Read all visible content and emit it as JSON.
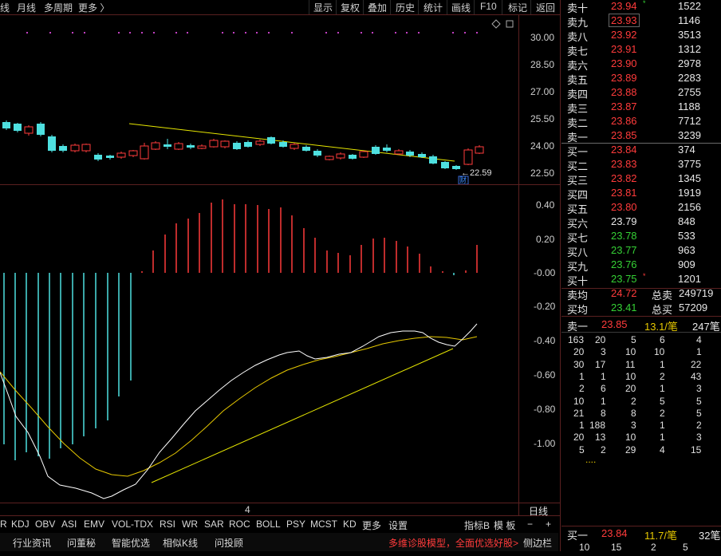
{
  "toolbar": {
    "left": [
      "线",
      "月线",
      "多周期",
      "更多 〉"
    ],
    "right": [
      "显示",
      "复权",
      "叠加",
      "历史",
      "统计",
      "画线",
      "F10",
      "标记",
      "返回"
    ]
  },
  "price_axis": [
    "30.00",
    "28.50",
    "27.00",
    "25.50",
    "24.00",
    "22.50"
  ],
  "price_annotation": "←22.59",
  "finance_marker": "财",
  "macd_axis": [
    "0.40",
    "0.20",
    "-0.00",
    "-0.20",
    "-0.40",
    "-0.60",
    "-0.80",
    "-1.00"
  ],
  "date_label": "4",
  "period_label": "日线",
  "indicators": [
    "R",
    "KDJ",
    "OBV",
    "ASI",
    "EMV",
    "VOL-TDX",
    "RSI",
    "WR",
    "SAR",
    "ROC",
    "BOLL",
    "PSY",
    "MCST",
    "KD",
    "更多",
    "设置"
  ],
  "indicator_controls": {
    "zhibiao": "指标B",
    "muban": "模 板",
    "minus": "−",
    "plus": "+"
  },
  "bottom_tabs": [
    "",
    "行业资讯",
    "问董秘",
    "智能优选",
    "相似K线",
    "问投顾"
  ],
  "promo": "多维诊股模型，全面优选好股>",
  "sidebar_toggle": "侧边栏",
  "sell_orders": [
    {
      "label": "卖十",
      "price": "23.94",
      "qty": "1522",
      "price_color": "red",
      "mark": "*"
    },
    {
      "label": "卖九",
      "price": "23.93",
      "qty": "1146",
      "price_color": "red"
    },
    {
      "label": "卖八",
      "price": "23.92",
      "qty": "3513",
      "price_color": "red"
    },
    {
      "label": "卖七",
      "price": "23.91",
      "qty": "1312",
      "price_color": "red"
    },
    {
      "label": "卖六",
      "price": "23.90",
      "qty": "2978",
      "price_color": "red"
    },
    {
      "label": "卖五",
      "price": "23.89",
      "qty": "2283",
      "price_color": "red"
    },
    {
      "label": "卖四",
      "price": "23.88",
      "qty": "2755",
      "price_color": "red"
    },
    {
      "label": "卖三",
      "price": "23.87",
      "qty": "1188",
      "price_color": "red"
    },
    {
      "label": "卖二",
      "price": "23.86",
      "qty": "7712",
      "price_color": "red"
    },
    {
      "label": "卖一",
      "price": "23.85",
      "qty": "3239",
      "price_color": "red"
    }
  ],
  "buy_orders": [
    {
      "label": "买一",
      "price": "23.84",
      "qty": "374",
      "price_color": "red"
    },
    {
      "label": "买二",
      "price": "23.83",
      "qty": "3775",
      "price_color": "red"
    },
    {
      "label": "买三",
      "price": "23.82",
      "qty": "1345",
      "price_color": "red"
    },
    {
      "label": "买四",
      "price": "23.81",
      "qty": "1919",
      "price_color": "red"
    },
    {
      "label": "买五",
      "price": "23.80",
      "qty": "2156",
      "price_color": "red"
    },
    {
      "label": "买六",
      "price": "23.79",
      "qty": "848",
      "price_color": "white"
    },
    {
      "label": "买七",
      "price": "23.78",
      "qty": "533",
      "price_color": "green"
    },
    {
      "label": "买八",
      "price": "23.77",
      "qty": "963",
      "price_color": "green"
    },
    {
      "label": "买九",
      "price": "23.76",
      "qty": "909",
      "price_color": "green"
    },
    {
      "label": "买十",
      "price": "23.75",
      "qty": "1201",
      "price_color": "green",
      "mark": "*"
    }
  ],
  "summary": [
    {
      "label": "卖均",
      "value": "24.72",
      "value_color": "red",
      "label2": "总卖",
      "value2": "249719"
    },
    {
      "label": "买均",
      "value": "23.41",
      "value_color": "green",
      "label2": "总买",
      "value2": "57209"
    }
  ],
  "queue_header": {
    "label": "卖一",
    "price": "23.85",
    "avg": "13.1/笔",
    "count": "247笔"
  },
  "queue": [
    [
      "163",
      "20",
      "5",
      "6",
      "4"
    ],
    [
      "20",
      "3",
      "10",
      "10",
      "1"
    ],
    [
      "30",
      "17",
      "11",
      "1",
      "22"
    ],
    [
      "1",
      "1",
      "10",
      "2",
      "43"
    ],
    [
      "2",
      "6",
      "20",
      "1",
      "3"
    ],
    [
      "10",
      "1",
      "2",
      "5",
      "5"
    ],
    [
      "21",
      "8",
      "8",
      "2",
      "5"
    ],
    [
      "1",
      "188",
      "3",
      "1",
      "2"
    ],
    [
      "20",
      "13",
      "10",
      "1",
      "3"
    ],
    [
      "5",
      "2",
      "29",
      "4",
      "15"
    ]
  ],
  "queue_more": "....",
  "bottom_queue_header": {
    "label": "买一",
    "price": "23.84",
    "avg": "11.7/笔",
    "count": "32笔"
  },
  "bottom_queue_row": [
    "10",
    "15",
    "2",
    "5",
    ""
  ],
  "colors": {
    "up": "#ff3b3b",
    "down": "#4ee0e0",
    "dif": "#ffffff",
    "dea": "#e6c800",
    "trend": "#e6e600",
    "frame": "#5a2020"
  }
}
